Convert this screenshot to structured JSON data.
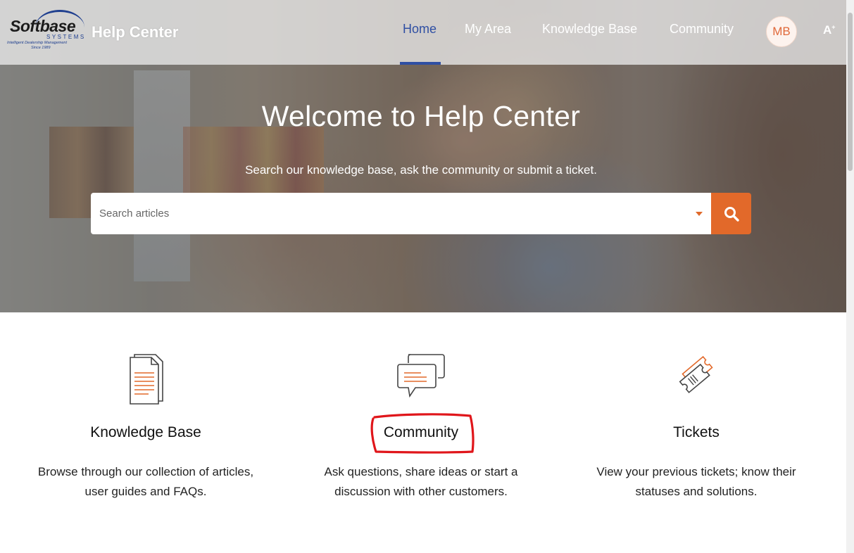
{
  "header": {
    "logo": {
      "brand": "Softbase",
      "systems": "SYSTEMS",
      "tagline": "Intelligent Dealership Management",
      "since": "Since 1989"
    },
    "title": "Help Center",
    "nav": [
      {
        "label": "Home",
        "active": true
      },
      {
        "label": "My Area",
        "active": false
      },
      {
        "label": "Knowledge Base",
        "active": false
      },
      {
        "label": "Community",
        "active": false
      }
    ],
    "avatar_initials": "MB",
    "font_size_icon": "A",
    "accent_color": "#2f4fa3"
  },
  "hero": {
    "title": "Welcome to Help Center",
    "subtitle": "Search our knowledge base, ask the community or submit a ticket.",
    "search": {
      "placeholder": "Search articles",
      "value": "",
      "button_icon": "search-icon",
      "button_color": "#e2692a"
    }
  },
  "cards": [
    {
      "icon": "document-icon",
      "title": "Knowledge Base",
      "desc_line1": "Browse through our collection of articles,",
      "desc_line2": "user guides and FAQs."
    },
    {
      "icon": "chat-bubbles-icon",
      "title": "Community",
      "desc_line1": "Ask questions, share ideas or start a",
      "desc_line2": "discussion with other customers.",
      "highlighted": true
    },
    {
      "icon": "ticket-icon",
      "title": "Tickets",
      "desc_line1": "View your previous tickets; know their",
      "desc_line2": "statuses and solutions."
    }
  ],
  "colors": {
    "orange": "#e2692a",
    "annotation_red": "#e0161b"
  }
}
